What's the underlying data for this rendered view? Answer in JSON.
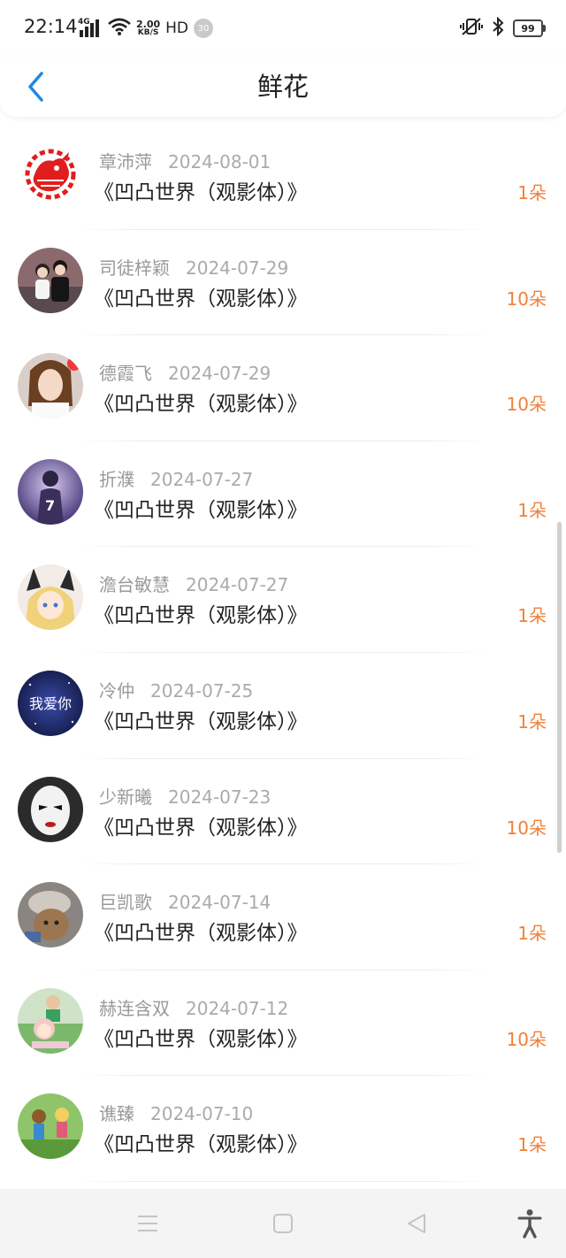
{
  "status_bar": {
    "time": "22:14",
    "network": "4G",
    "speed_value": "2.00",
    "speed_unit": "KB/S",
    "hd": "HD",
    "notification_count": "30",
    "battery": "99",
    "icons": [
      "signal-icon",
      "wifi-icon",
      "vibrate-icon",
      "bluetooth-icon",
      "battery-icon"
    ]
  },
  "header": {
    "title": "鲜花",
    "accent_color": "#1e88e5"
  },
  "list": [
    {
      "name": "章沛萍",
      "date": "2024-08-01",
      "book": "《凹凸世界（观影体）》",
      "amount": "1朵",
      "avatar": "paper-cut-rooster"
    },
    {
      "name": "司徒梓颖",
      "date": "2024-07-29",
      "book": "《凹凸世界（观影体）》",
      "amount": "10朵",
      "avatar": "couple-photo"
    },
    {
      "name": "德霞飞",
      "date": "2024-07-29",
      "book": "《凹凸世界（观影体）》",
      "amount": "10朵",
      "avatar": "girl-selfie"
    },
    {
      "name": "折濮",
      "date": "2024-07-27",
      "book": "《凹凸世界（观影体）》",
      "amount": "1朵",
      "avatar": "jersey-7-art"
    },
    {
      "name": "澹台敏慧",
      "date": "2024-07-27",
      "book": "《凹凸世界（观影体）》",
      "amount": "1朵",
      "avatar": "anime-bunny-girl"
    },
    {
      "name": "冷仲",
      "date": "2024-07-25",
      "book": "《凹凸世界（观影体）》",
      "amount": "1朵",
      "avatar": "galaxy-text",
      "avatar_text": "我爱你"
    },
    {
      "name": "少新曦",
      "date": "2024-07-23",
      "book": "《凹凸世界（观影体）》",
      "amount": "10朵",
      "avatar": "mime-face"
    },
    {
      "name": "巨凯歌",
      "date": "2024-07-14",
      "book": "《凹凸世界（观影体）》",
      "amount": "1朵",
      "avatar": "dog-photo"
    },
    {
      "name": "赫连含双",
      "date": "2024-07-12",
      "book": "《凹凸世界（观影体）》",
      "amount": "10朵",
      "avatar": "cartoon-kids"
    },
    {
      "name": "谯臻",
      "date": "2024-07-10",
      "book": "《凹凸世界（观影体）》",
      "amount": "1朵",
      "avatar": "cartoon-dolls"
    }
  ],
  "amount_color": "#f0813a",
  "nav_bar": {
    "icons": [
      "menu-icon",
      "home-icon",
      "back-triangle-icon",
      "accessibility-icon"
    ]
  }
}
